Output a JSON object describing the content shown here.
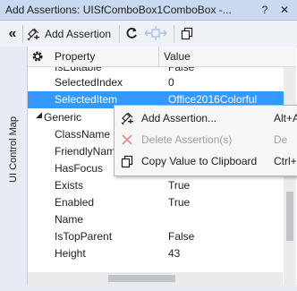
{
  "title_bar": {
    "title": "Add Assertions: UISfComboBox1ComboBox -...",
    "help_glyph": "?",
    "close_glyph": "✕"
  },
  "toolbar": {
    "collapse_glyph": "«",
    "add_assertion_label": "Add Assertion"
  },
  "side_tab": {
    "label": "UI Control Map"
  },
  "grid": {
    "header": {
      "property": "Property",
      "value": "Value"
    },
    "top_rows": [
      {
        "name": "IsEditable",
        "value": "False"
      },
      {
        "name": "SelectedIndex",
        "value": "0"
      },
      {
        "name": "SelectedItem",
        "value": "Office2016Colorful",
        "selected": true
      }
    ],
    "category": {
      "toggle_glyph": "◢",
      "name": "Generic"
    },
    "generic_rows": [
      {
        "name": "ClassName",
        "value": ""
      },
      {
        "name": "FriendlyNam",
        "value": ""
      },
      {
        "name": "HasFocus",
        "value": ""
      },
      {
        "name": "Exists",
        "value": "True"
      },
      {
        "name": "Enabled",
        "value": "True"
      },
      {
        "name": "Name",
        "value": ""
      },
      {
        "name": "IsTopParent",
        "value": "False"
      },
      {
        "name": "Height",
        "value": "43"
      }
    ]
  },
  "context_menu": {
    "items": [
      {
        "label": "Add Assertion...",
        "shortcut": "Alt+A",
        "enabled": true,
        "icon": "add-assertion-icon"
      },
      {
        "label": "Delete Assertion(s)",
        "shortcut": "De",
        "enabled": false,
        "icon": "delete-x-icon"
      },
      {
        "label": "Copy Value to Clipboard",
        "shortcut": "Ctrl+C",
        "enabled": true,
        "icon": "copy-icon"
      }
    ]
  },
  "colors": {
    "selection": "#3399ff",
    "title_bar": "#c9daf0",
    "delete_icon": "#e05a5a",
    "icon_stroke": "#1e1e1e"
  }
}
